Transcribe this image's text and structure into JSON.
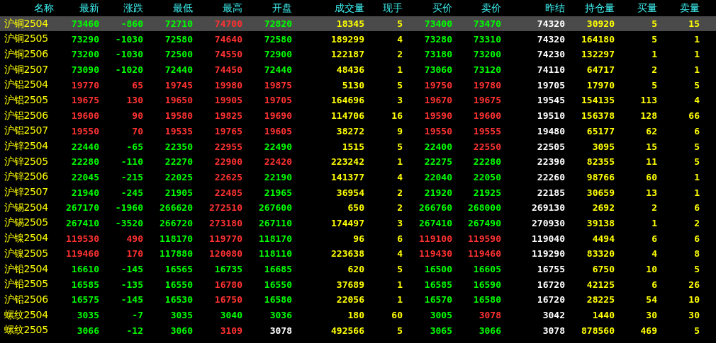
{
  "columns": [
    "名称",
    "最新",
    "涨跌",
    "最低",
    "最高",
    "开盘",
    "成交量",
    "现手",
    "买价",
    "卖价",
    "昨结",
    "持仓量",
    "买量",
    "卖量"
  ],
  "rows": [
    {
      "name": "沪铜2504",
      "selected": true,
      "cells": [
        {
          "text": "73460",
          "color": "#00ff00"
        },
        {
          "text": "-860",
          "color": "#00ff00"
        },
        {
          "text": "72710",
          "color": "#00ff00"
        },
        {
          "text": "74700",
          "color": "#ff3232"
        },
        {
          "text": "72820",
          "color": "#00ff00"
        },
        {
          "text": "18345",
          "color": "#ffff00"
        },
        {
          "text": "5",
          "color": "#ffff00"
        },
        {
          "text": "73400",
          "color": "#00ff00"
        },
        {
          "text": "73470",
          "color": "#00ff00"
        },
        {
          "text": "74320",
          "color": "#ffffff"
        },
        {
          "text": "30920",
          "color": "#ffff00"
        },
        {
          "text": "5",
          "color": "#ffff00"
        },
        {
          "text": "15",
          "color": "#ffff00"
        }
      ]
    },
    {
      "name": "沪铜2505",
      "selected": false,
      "cells": [
        {
          "text": "73290",
          "color": "#00ff00"
        },
        {
          "text": "-1030",
          "color": "#00ff00"
        },
        {
          "text": "72580",
          "color": "#00ff00"
        },
        {
          "text": "74640",
          "color": "#ff3232"
        },
        {
          "text": "72580",
          "color": "#00ff00"
        },
        {
          "text": "189299",
          "color": "#ffff00"
        },
        {
          "text": "4",
          "color": "#ffff00"
        },
        {
          "text": "73280",
          "color": "#00ff00"
        },
        {
          "text": "73310",
          "color": "#00ff00"
        },
        {
          "text": "74320",
          "color": "#ffffff"
        },
        {
          "text": "164180",
          "color": "#ffff00"
        },
        {
          "text": "5",
          "color": "#ffff00"
        },
        {
          "text": "1",
          "color": "#ffff00"
        }
      ]
    },
    {
      "name": "沪铜2506",
      "selected": false,
      "cells": [
        {
          "text": "73200",
          "color": "#00ff00"
        },
        {
          "text": "-1030",
          "color": "#00ff00"
        },
        {
          "text": "72500",
          "color": "#00ff00"
        },
        {
          "text": "74550",
          "color": "#ff3232"
        },
        {
          "text": "72900",
          "color": "#00ff00"
        },
        {
          "text": "122187",
          "color": "#ffff00"
        },
        {
          "text": "2",
          "color": "#ffff00"
        },
        {
          "text": "73180",
          "color": "#00ff00"
        },
        {
          "text": "73200",
          "color": "#00ff00"
        },
        {
          "text": "74230",
          "color": "#ffffff"
        },
        {
          "text": "132297",
          "color": "#ffff00"
        },
        {
          "text": "1",
          "color": "#ffff00"
        },
        {
          "text": "1",
          "color": "#ffff00"
        }
      ]
    },
    {
      "name": "沪铜2507",
      "selected": false,
      "cells": [
        {
          "text": "73090",
          "color": "#00ff00"
        },
        {
          "text": "-1020",
          "color": "#00ff00"
        },
        {
          "text": "72440",
          "color": "#00ff00"
        },
        {
          "text": "74450",
          "color": "#ff3232"
        },
        {
          "text": "72440",
          "color": "#00ff00"
        },
        {
          "text": "48436",
          "color": "#ffff00"
        },
        {
          "text": "1",
          "color": "#ffff00"
        },
        {
          "text": "73060",
          "color": "#00ff00"
        },
        {
          "text": "73120",
          "color": "#00ff00"
        },
        {
          "text": "74110",
          "color": "#ffffff"
        },
        {
          "text": "64717",
          "color": "#ffff00"
        },
        {
          "text": "2",
          "color": "#ffff00"
        },
        {
          "text": "1",
          "color": "#ffff00"
        }
      ]
    },
    {
      "name": "沪铝2504",
      "selected": false,
      "cells": [
        {
          "text": "19770",
          "color": "#ff3232"
        },
        {
          "text": "65",
          "color": "#ff3232"
        },
        {
          "text": "19745",
          "color": "#ff3232"
        },
        {
          "text": "19980",
          "color": "#ff3232"
        },
        {
          "text": "19875",
          "color": "#ff3232"
        },
        {
          "text": "5130",
          "color": "#ffff00"
        },
        {
          "text": "5",
          "color": "#ffff00"
        },
        {
          "text": "19750",
          "color": "#ff3232"
        },
        {
          "text": "19780",
          "color": "#ff3232"
        },
        {
          "text": "19705",
          "color": "#ffffff"
        },
        {
          "text": "17970",
          "color": "#ffff00"
        },
        {
          "text": "5",
          "color": "#ffff00"
        },
        {
          "text": "5",
          "color": "#ffff00"
        }
      ]
    },
    {
      "name": "沪铝2505",
      "selected": false,
      "cells": [
        {
          "text": "19675",
          "color": "#ff3232"
        },
        {
          "text": "130",
          "color": "#ff3232"
        },
        {
          "text": "19650",
          "color": "#ff3232"
        },
        {
          "text": "19905",
          "color": "#ff3232"
        },
        {
          "text": "19705",
          "color": "#ff3232"
        },
        {
          "text": "164696",
          "color": "#ffff00"
        },
        {
          "text": "3",
          "color": "#ffff00"
        },
        {
          "text": "19670",
          "color": "#ff3232"
        },
        {
          "text": "19675",
          "color": "#ff3232"
        },
        {
          "text": "19545",
          "color": "#ffffff"
        },
        {
          "text": "154135",
          "color": "#ffff00"
        },
        {
          "text": "113",
          "color": "#ffff00"
        },
        {
          "text": "4",
          "color": "#ffff00"
        }
      ]
    },
    {
      "name": "沪铝2506",
      "selected": false,
      "cells": [
        {
          "text": "19600",
          "color": "#ff3232"
        },
        {
          "text": "90",
          "color": "#ff3232"
        },
        {
          "text": "19580",
          "color": "#ff3232"
        },
        {
          "text": "19825",
          "color": "#ff3232"
        },
        {
          "text": "19690",
          "color": "#ff3232"
        },
        {
          "text": "114706",
          "color": "#ffff00"
        },
        {
          "text": "16",
          "color": "#ffff00"
        },
        {
          "text": "19590",
          "color": "#ff3232"
        },
        {
          "text": "19600",
          "color": "#ff3232"
        },
        {
          "text": "19510",
          "color": "#ffffff"
        },
        {
          "text": "156378",
          "color": "#ffff00"
        },
        {
          "text": "128",
          "color": "#ffff00"
        },
        {
          "text": "66",
          "color": "#ffff00"
        }
      ]
    },
    {
      "name": "沪铝2507",
      "selected": false,
      "cells": [
        {
          "text": "19550",
          "color": "#ff3232"
        },
        {
          "text": "70",
          "color": "#ff3232"
        },
        {
          "text": "19535",
          "color": "#ff3232"
        },
        {
          "text": "19765",
          "color": "#ff3232"
        },
        {
          "text": "19605",
          "color": "#ff3232"
        },
        {
          "text": "38272",
          "color": "#ffff00"
        },
        {
          "text": "9",
          "color": "#ffff00"
        },
        {
          "text": "19550",
          "color": "#ff3232"
        },
        {
          "text": "19555",
          "color": "#ff3232"
        },
        {
          "text": "19480",
          "color": "#ffffff"
        },
        {
          "text": "65177",
          "color": "#ffff00"
        },
        {
          "text": "62",
          "color": "#ffff00"
        },
        {
          "text": "6",
          "color": "#ffff00"
        }
      ]
    },
    {
      "name": "沪锌2504",
      "selected": false,
      "cells": [
        {
          "text": "22440",
          "color": "#00ff00"
        },
        {
          "text": "-65",
          "color": "#00ff00"
        },
        {
          "text": "22350",
          "color": "#00ff00"
        },
        {
          "text": "22955",
          "color": "#ff3232"
        },
        {
          "text": "22490",
          "color": "#00ff00"
        },
        {
          "text": "1515",
          "color": "#ffff00"
        },
        {
          "text": "5",
          "color": "#ffff00"
        },
        {
          "text": "22400",
          "color": "#00ff00"
        },
        {
          "text": "22550",
          "color": "#ff3232"
        },
        {
          "text": "22505",
          "color": "#ffffff"
        },
        {
          "text": "3095",
          "color": "#ffff00"
        },
        {
          "text": "15",
          "color": "#ffff00"
        },
        {
          "text": "5",
          "color": "#ffff00"
        }
      ]
    },
    {
      "name": "沪锌2505",
      "selected": false,
      "cells": [
        {
          "text": "22280",
          "color": "#00ff00"
        },
        {
          "text": "-110",
          "color": "#00ff00"
        },
        {
          "text": "22270",
          "color": "#00ff00"
        },
        {
          "text": "22900",
          "color": "#ff3232"
        },
        {
          "text": "22420",
          "color": "#ff3232"
        },
        {
          "text": "223242",
          "color": "#ffff00"
        },
        {
          "text": "1",
          "color": "#ffff00"
        },
        {
          "text": "22275",
          "color": "#00ff00"
        },
        {
          "text": "22280",
          "color": "#00ff00"
        },
        {
          "text": "22390",
          "color": "#ffffff"
        },
        {
          "text": "82355",
          "color": "#ffff00"
        },
        {
          "text": "11",
          "color": "#ffff00"
        },
        {
          "text": "5",
          "color": "#ffff00"
        }
      ]
    },
    {
      "name": "沪锌2506",
      "selected": false,
      "cells": [
        {
          "text": "22045",
          "color": "#00ff00"
        },
        {
          "text": "-215",
          "color": "#00ff00"
        },
        {
          "text": "22025",
          "color": "#00ff00"
        },
        {
          "text": "22625",
          "color": "#ff3232"
        },
        {
          "text": "22190",
          "color": "#00ff00"
        },
        {
          "text": "141377",
          "color": "#ffff00"
        },
        {
          "text": "4",
          "color": "#ffff00"
        },
        {
          "text": "22040",
          "color": "#00ff00"
        },
        {
          "text": "22050",
          "color": "#00ff00"
        },
        {
          "text": "22260",
          "color": "#ffffff"
        },
        {
          "text": "98766",
          "color": "#ffff00"
        },
        {
          "text": "60",
          "color": "#ffff00"
        },
        {
          "text": "1",
          "color": "#ffff00"
        }
      ]
    },
    {
      "name": "沪锌2507",
      "selected": false,
      "cells": [
        {
          "text": "21940",
          "color": "#00ff00"
        },
        {
          "text": "-245",
          "color": "#00ff00"
        },
        {
          "text": "21905",
          "color": "#00ff00"
        },
        {
          "text": "22485",
          "color": "#ff3232"
        },
        {
          "text": "21965",
          "color": "#00ff00"
        },
        {
          "text": "36954",
          "color": "#ffff00"
        },
        {
          "text": "2",
          "color": "#ffff00"
        },
        {
          "text": "21920",
          "color": "#00ff00"
        },
        {
          "text": "21925",
          "color": "#00ff00"
        },
        {
          "text": "22185",
          "color": "#ffffff"
        },
        {
          "text": "30659",
          "color": "#ffff00"
        },
        {
          "text": "13",
          "color": "#ffff00"
        },
        {
          "text": "1",
          "color": "#ffff00"
        }
      ]
    },
    {
      "name": "沪锡2504",
      "selected": false,
      "cells": [
        {
          "text": "267170",
          "color": "#00ff00"
        },
        {
          "text": "-1960",
          "color": "#00ff00"
        },
        {
          "text": "266620",
          "color": "#00ff00"
        },
        {
          "text": "272510",
          "color": "#ff3232"
        },
        {
          "text": "267600",
          "color": "#00ff00"
        },
        {
          "text": "650",
          "color": "#ffff00"
        },
        {
          "text": "2",
          "color": "#ffff00"
        },
        {
          "text": "266760",
          "color": "#00ff00"
        },
        {
          "text": "268000",
          "color": "#00ff00"
        },
        {
          "text": "269130",
          "color": "#ffffff"
        },
        {
          "text": "2692",
          "color": "#ffff00"
        },
        {
          "text": "2",
          "color": "#ffff00"
        },
        {
          "text": "6",
          "color": "#ffff00"
        }
      ]
    },
    {
      "name": "沪锡2505",
      "selected": false,
      "cells": [
        {
          "text": "267410",
          "color": "#00ff00"
        },
        {
          "text": "-3520",
          "color": "#00ff00"
        },
        {
          "text": "266720",
          "color": "#00ff00"
        },
        {
          "text": "273180",
          "color": "#ff3232"
        },
        {
          "text": "267110",
          "color": "#00ff00"
        },
        {
          "text": "174497",
          "color": "#ffff00"
        },
        {
          "text": "3",
          "color": "#ffff00"
        },
        {
          "text": "267410",
          "color": "#00ff00"
        },
        {
          "text": "267490",
          "color": "#00ff00"
        },
        {
          "text": "270930",
          "color": "#ffffff"
        },
        {
          "text": "39138",
          "color": "#ffff00"
        },
        {
          "text": "1",
          "color": "#ffff00"
        },
        {
          "text": "2",
          "color": "#ffff00"
        }
      ]
    },
    {
      "name": "沪镍2504",
      "selected": false,
      "cells": [
        {
          "text": "119530",
          "color": "#ff3232"
        },
        {
          "text": "490",
          "color": "#ff3232"
        },
        {
          "text": "118170",
          "color": "#00ff00"
        },
        {
          "text": "119770",
          "color": "#ff3232"
        },
        {
          "text": "118170",
          "color": "#00ff00"
        },
        {
          "text": "96",
          "color": "#ffff00"
        },
        {
          "text": "6",
          "color": "#ffff00"
        },
        {
          "text": "119100",
          "color": "#ff3232"
        },
        {
          "text": "119590",
          "color": "#ff3232"
        },
        {
          "text": "119040",
          "color": "#ffffff"
        },
        {
          "text": "4494",
          "color": "#ffff00"
        },
        {
          "text": "6",
          "color": "#ffff00"
        },
        {
          "text": "6",
          "color": "#ffff00"
        }
      ]
    },
    {
      "name": "沪镍2505",
      "selected": false,
      "cells": [
        {
          "text": "119460",
          "color": "#ff3232"
        },
        {
          "text": "170",
          "color": "#ff3232"
        },
        {
          "text": "117880",
          "color": "#00ff00"
        },
        {
          "text": "120080",
          "color": "#ff3232"
        },
        {
          "text": "118110",
          "color": "#00ff00"
        },
        {
          "text": "223638",
          "color": "#ffff00"
        },
        {
          "text": "4",
          "color": "#ffff00"
        },
        {
          "text": "119430",
          "color": "#ff3232"
        },
        {
          "text": "119460",
          "color": "#ff3232"
        },
        {
          "text": "119290",
          "color": "#ffffff"
        },
        {
          "text": "83320",
          "color": "#ffff00"
        },
        {
          "text": "4",
          "color": "#ffff00"
        },
        {
          "text": "8",
          "color": "#ffff00"
        }
      ]
    },
    {
      "name": "沪铅2504",
      "selected": false,
      "cells": [
        {
          "text": "16610",
          "color": "#00ff00"
        },
        {
          "text": "-145",
          "color": "#00ff00"
        },
        {
          "text": "16565",
          "color": "#00ff00"
        },
        {
          "text": "16735",
          "color": "#00ff00"
        },
        {
          "text": "16685",
          "color": "#00ff00"
        },
        {
          "text": "620",
          "color": "#ffff00"
        },
        {
          "text": "5",
          "color": "#ffff00"
        },
        {
          "text": "16500",
          "color": "#00ff00"
        },
        {
          "text": "16605",
          "color": "#00ff00"
        },
        {
          "text": "16755",
          "color": "#ffffff"
        },
        {
          "text": "6750",
          "color": "#ffff00"
        },
        {
          "text": "10",
          "color": "#ffff00"
        },
        {
          "text": "5",
          "color": "#ffff00"
        }
      ]
    },
    {
      "name": "沪铅2505",
      "selected": false,
      "cells": [
        {
          "text": "16585",
          "color": "#00ff00"
        },
        {
          "text": "-135",
          "color": "#00ff00"
        },
        {
          "text": "16550",
          "color": "#00ff00"
        },
        {
          "text": "16780",
          "color": "#ff3232"
        },
        {
          "text": "16550",
          "color": "#00ff00"
        },
        {
          "text": "37689",
          "color": "#ffff00"
        },
        {
          "text": "1",
          "color": "#ffff00"
        },
        {
          "text": "16585",
          "color": "#00ff00"
        },
        {
          "text": "16590",
          "color": "#00ff00"
        },
        {
          "text": "16720",
          "color": "#ffffff"
        },
        {
          "text": "42125",
          "color": "#ffff00"
        },
        {
          "text": "6",
          "color": "#ffff00"
        },
        {
          "text": "26",
          "color": "#ffff00"
        }
      ]
    },
    {
      "name": "沪铅2506",
      "selected": false,
      "cells": [
        {
          "text": "16575",
          "color": "#00ff00"
        },
        {
          "text": "-145",
          "color": "#00ff00"
        },
        {
          "text": "16530",
          "color": "#00ff00"
        },
        {
          "text": "16750",
          "color": "#ff3232"
        },
        {
          "text": "16580",
          "color": "#00ff00"
        },
        {
          "text": "22056",
          "color": "#ffff00"
        },
        {
          "text": "1",
          "color": "#ffff00"
        },
        {
          "text": "16570",
          "color": "#00ff00"
        },
        {
          "text": "16580",
          "color": "#00ff00"
        },
        {
          "text": "16720",
          "color": "#ffffff"
        },
        {
          "text": "28225",
          "color": "#ffff00"
        },
        {
          "text": "54",
          "color": "#ffff00"
        },
        {
          "text": "10",
          "color": "#ffff00"
        }
      ]
    },
    {
      "name": "螺纹2504",
      "selected": false,
      "cells": [
        {
          "text": "3035",
          "color": "#00ff00"
        },
        {
          "text": "-7",
          "color": "#00ff00"
        },
        {
          "text": "3035",
          "color": "#00ff00"
        },
        {
          "text": "3040",
          "color": "#00ff00"
        },
        {
          "text": "3036",
          "color": "#00ff00"
        },
        {
          "text": "180",
          "color": "#ffff00"
        },
        {
          "text": "60",
          "color": "#ffff00"
        },
        {
          "text": "3005",
          "color": "#00ff00"
        },
        {
          "text": "3078",
          "color": "#ff3232"
        },
        {
          "text": "3042",
          "color": "#ffffff"
        },
        {
          "text": "1440",
          "color": "#ffff00"
        },
        {
          "text": "30",
          "color": "#ffff00"
        },
        {
          "text": "30",
          "color": "#ffff00"
        }
      ]
    },
    {
      "name": "螺纹2505",
      "selected": false,
      "cells": [
        {
          "text": "3066",
          "color": "#00ff00"
        },
        {
          "text": "-12",
          "color": "#00ff00"
        },
        {
          "text": "3060",
          "color": "#00ff00"
        },
        {
          "text": "3109",
          "color": "#ff3232"
        },
        {
          "text": "3078",
          "color": "#ffffff"
        },
        {
          "text": "492566",
          "color": "#ffff00"
        },
        {
          "text": "5",
          "color": "#ffff00"
        },
        {
          "text": "3065",
          "color": "#00ff00"
        },
        {
          "text": "3066",
          "color": "#00ff00"
        },
        {
          "text": "3078",
          "color": "#ffffff"
        },
        {
          "text": "878560",
          "color": "#ffff00"
        },
        {
          "text": "469",
          "color": "#ffff00"
        },
        {
          "text": "5",
          "color": "#ffff00"
        }
      ]
    }
  ]
}
